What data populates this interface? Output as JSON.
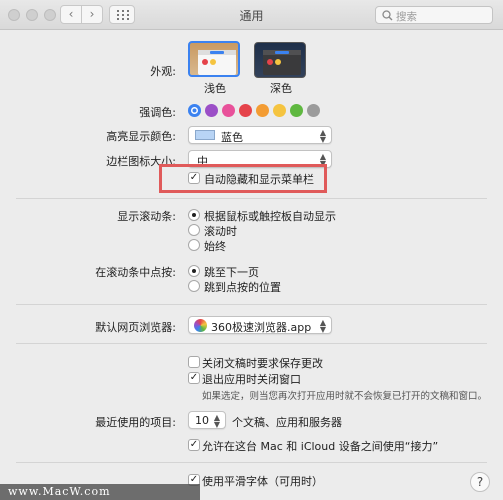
{
  "window": {
    "title": "通用"
  },
  "search": {
    "placeholder": "搜索"
  },
  "appearance": {
    "label": "外观:",
    "options": [
      "浅色",
      "深色"
    ],
    "selected": "浅色"
  },
  "accent": {
    "label": "强调色:",
    "colors": [
      "#3b82f0",
      "#9b4fc7",
      "#e8519a",
      "#e5434a",
      "#f39c33",
      "#f5c440",
      "#5fb840",
      "#9b9b9b"
    ]
  },
  "highlight": {
    "label": "高亮显示颜色:",
    "value": "蓝色",
    "swatch": "#b8d4f5"
  },
  "sidebar_icon": {
    "label": "边栏图标大小:",
    "value": "中"
  },
  "auto_hide": {
    "label": "自动隐藏和显示菜单栏",
    "checked": true
  },
  "scrollbars": {
    "label": "显示滚动条:",
    "options": [
      "根据鼠标或触控板自动显示",
      "滚动时",
      "始终"
    ],
    "selected": 0
  },
  "click_scrollbar": {
    "label": "在滚动条中点按:",
    "options": [
      "跳至下一页",
      "跳到点按的位置"
    ],
    "selected": 0
  },
  "browser": {
    "label": "默认网页浏览器:",
    "value": "360极速浏览器.app"
  },
  "close_docs": {
    "label": "关闭文稿时要求保存更改",
    "checked": false
  },
  "close_windows": {
    "label": "退出应用时关闭窗口",
    "checked": true
  },
  "close_windows_note": "如果选定，则当您再次打开应用时就不会恢复已打开的文稿和窗口。",
  "recent": {
    "label": "最近使用的项目:",
    "value": "10",
    "suffix": "个文稿、应用和服务器"
  },
  "handoff": {
    "label": "允许在这台 Mac 和 iCloud 设备之间使用“接力”",
    "checked": true
  },
  "font_smoothing": {
    "label": "使用平滑字体（可用时）",
    "checked": true
  },
  "help": "?",
  "watermark": "www.MacW.com"
}
